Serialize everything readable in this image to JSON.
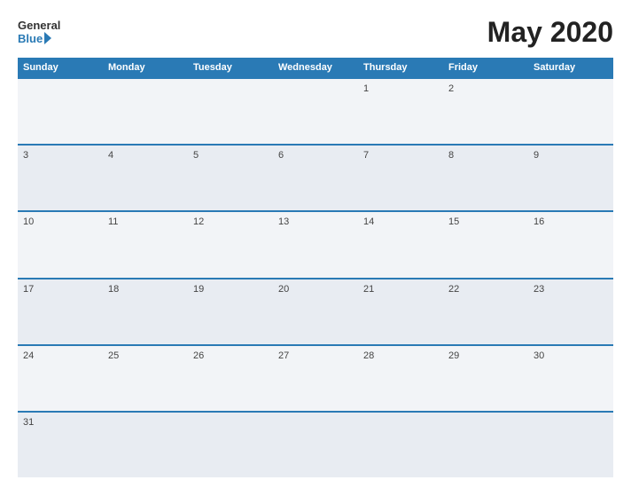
{
  "header": {
    "logo_general": "General",
    "logo_blue": "Blue",
    "title": "May 2020"
  },
  "calendar": {
    "day_headers": [
      "Sunday",
      "Monday",
      "Tuesday",
      "Wednesday",
      "Thursday",
      "Friday",
      "Saturday"
    ],
    "weeks": [
      [
        {
          "num": "",
          "empty": true
        },
        {
          "num": "",
          "empty": true
        },
        {
          "num": "",
          "empty": true
        },
        {
          "num": "",
          "empty": true
        },
        {
          "num": "1",
          "empty": false
        },
        {
          "num": "2",
          "empty": false
        },
        {
          "num": "",
          "empty": true
        }
      ],
      [
        {
          "num": "3",
          "empty": false
        },
        {
          "num": "4",
          "empty": false
        },
        {
          "num": "5",
          "empty": false
        },
        {
          "num": "6",
          "empty": false
        },
        {
          "num": "7",
          "empty": false
        },
        {
          "num": "8",
          "empty": false
        },
        {
          "num": "9",
          "empty": false
        }
      ],
      [
        {
          "num": "10",
          "empty": false
        },
        {
          "num": "11",
          "empty": false
        },
        {
          "num": "12",
          "empty": false
        },
        {
          "num": "13",
          "empty": false
        },
        {
          "num": "14",
          "empty": false
        },
        {
          "num": "15",
          "empty": false
        },
        {
          "num": "16",
          "empty": false
        }
      ],
      [
        {
          "num": "17",
          "empty": false
        },
        {
          "num": "18",
          "empty": false
        },
        {
          "num": "19",
          "empty": false
        },
        {
          "num": "20",
          "empty": false
        },
        {
          "num": "21",
          "empty": false
        },
        {
          "num": "22",
          "empty": false
        },
        {
          "num": "23",
          "empty": false
        }
      ],
      [
        {
          "num": "24",
          "empty": false
        },
        {
          "num": "25",
          "empty": false
        },
        {
          "num": "26",
          "empty": false
        },
        {
          "num": "27",
          "empty": false
        },
        {
          "num": "28",
          "empty": false
        },
        {
          "num": "29",
          "empty": false
        },
        {
          "num": "30",
          "empty": false
        }
      ],
      [
        {
          "num": "31",
          "empty": false
        },
        {
          "num": "",
          "empty": true
        },
        {
          "num": "",
          "empty": true
        },
        {
          "num": "",
          "empty": true
        },
        {
          "num": "",
          "empty": true
        },
        {
          "num": "",
          "empty": true
        },
        {
          "num": "",
          "empty": true
        }
      ]
    ]
  }
}
